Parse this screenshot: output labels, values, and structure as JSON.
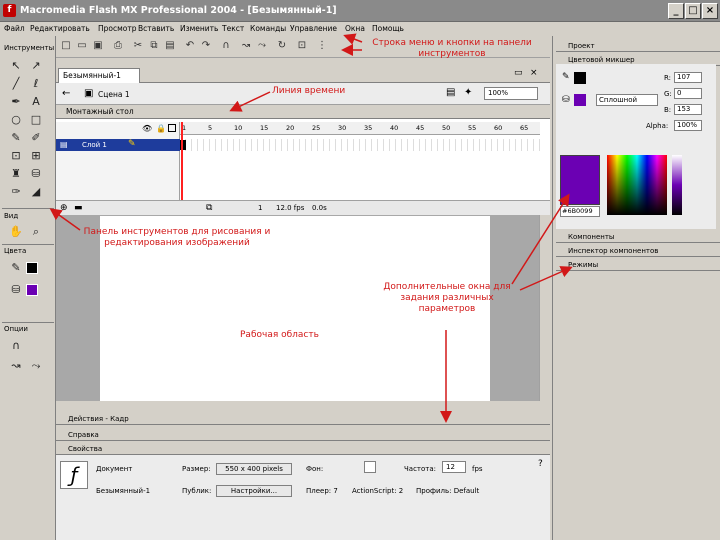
{
  "window": {
    "title": "Macromedia Flash MX Professional 2004 - [Безымянный-1]",
    "icon": "flash-app-icon"
  },
  "menu": [
    "Файл",
    "Редактировать",
    "Просмотр",
    "Вставить",
    "Изменить",
    "Текст",
    "Команды",
    "Управление",
    "Окна",
    "Помощь"
  ],
  "tools_panel": {
    "title": "Инструменты",
    "view_label": "Вид",
    "colors_label": "Цвета",
    "options_label": "Опции"
  },
  "document": {
    "tab": "Безымянный-1",
    "scene": "Сцена 1",
    "zoom": "100%",
    "timeline_title": "Монтажный стол",
    "layer_name": "Слой 1",
    "frame_numbers": [
      "1",
      "5",
      "10",
      "15",
      "20",
      "25",
      "30",
      "35",
      "40",
      "45",
      "50",
      "55",
      "60",
      "65"
    ],
    "fps": "12.0 fps",
    "time": "0.0s",
    "frame_current": "1"
  },
  "bottom_panels": {
    "actions": "Действия - Кадр",
    "help": "Справка",
    "properties": "Свойства"
  },
  "properties": {
    "doc_label": "Документ",
    "doc_name": "Безымянный-1",
    "size_label": "Размер:",
    "size_value": "550 x 400 pixels",
    "publish_label": "Публик:",
    "settings_button": "Настройки...",
    "bg_label": "Фон:",
    "rate_label": "Частота:",
    "rate_value": "12",
    "fps_unit": "fps",
    "player": "Плеер: 7",
    "actionscript": "ActionScript: 2",
    "profile": "Профиль: Default"
  },
  "right_panel": {
    "project": "Проект",
    "color_mixer": "Цветовой микшер",
    "r_label": "R:",
    "r_value": "107",
    "g_label": "G:",
    "g_value": "0",
    "b_label": "B:",
    "b_value": "153",
    "alpha_label": "Alpha:",
    "alpha_value": "100%",
    "fill_type": "Сплошной",
    "hex": "#6B0099",
    "components": "Компоненты",
    "inspector": "Инспектор компонентов",
    "behaviors": "Режимы"
  },
  "annotations": {
    "menu_toolbar": "Строка меню и кнопки на панели инструментов",
    "timeline": "Линия времени",
    "tools": "Панель инструментов для рисования и редактирования изображений",
    "panels": "Дополнительные окна для задания различных параметров",
    "workspace": "Рабочая область"
  },
  "colors": {
    "annotation": "#d21818",
    "swatch": "#6b00b3",
    "layer_highlight": "#1e3c9c"
  }
}
